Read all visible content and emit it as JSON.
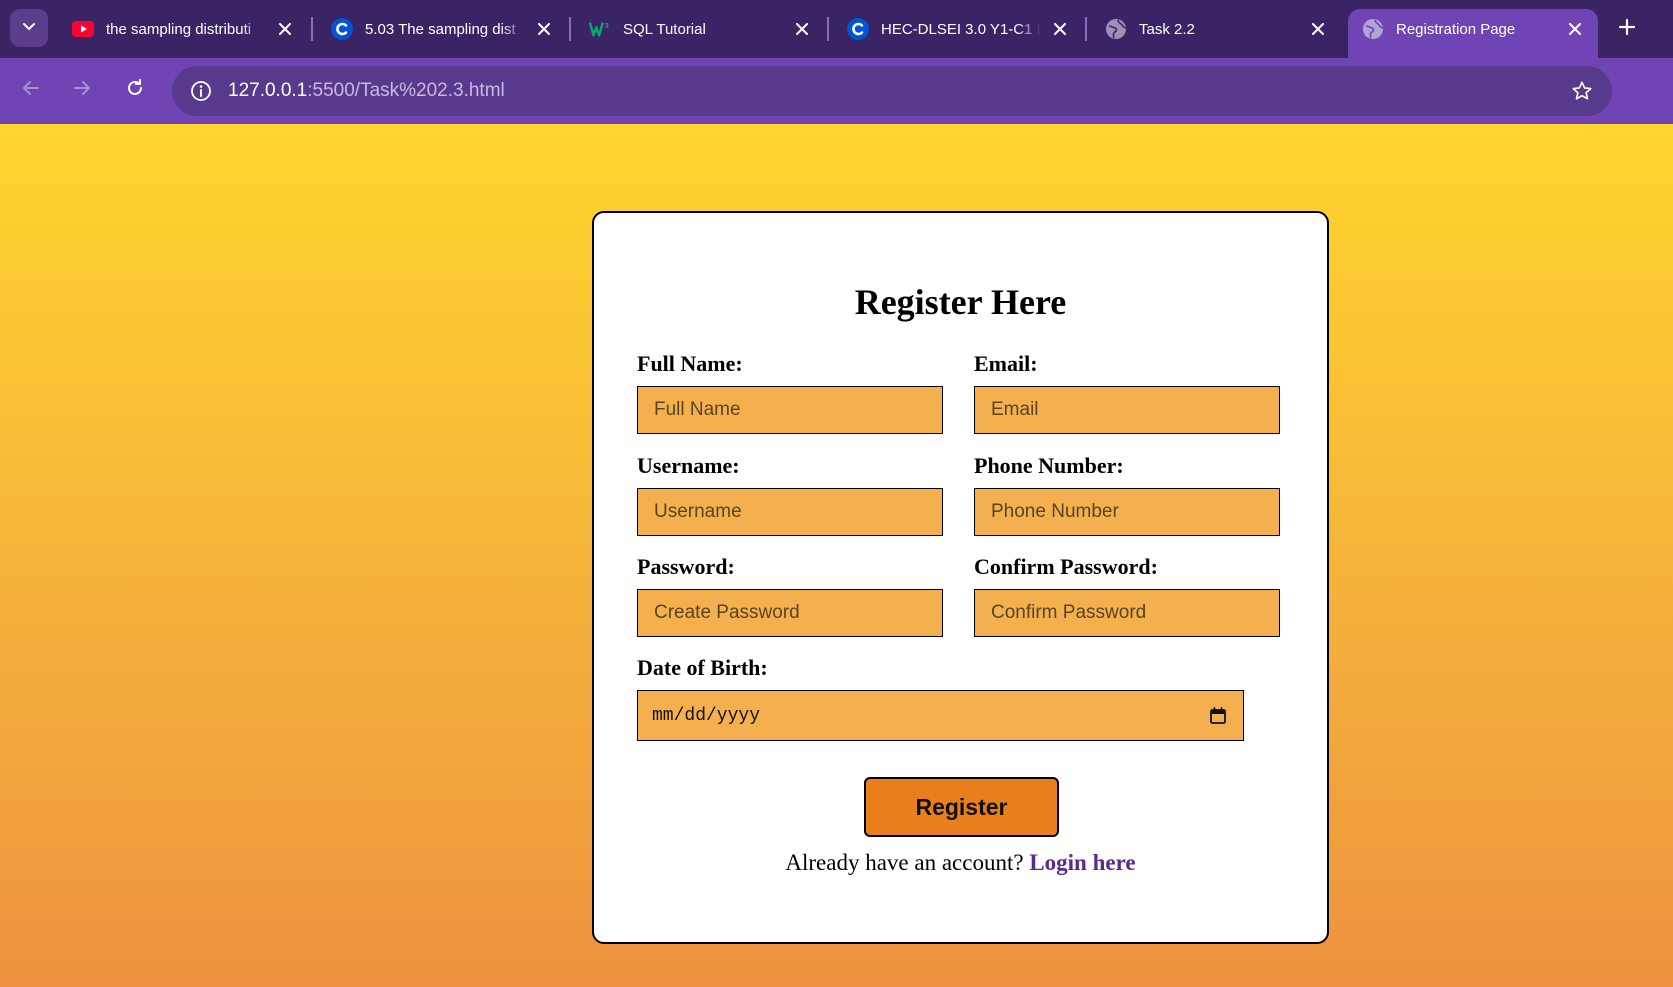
{
  "browser": {
    "tabs": [
      {
        "title": "the sampling distributi",
        "icon": "youtube-icon"
      },
      {
        "title": "5.03 The sampling dist",
        "icon": "coursera-icon"
      },
      {
        "title": "SQL Tutorial",
        "icon": "w3schools-icon"
      },
      {
        "title": "HEC-DLSEI 3.0 Y1-C1 I",
        "icon": "coursera-icon"
      },
      {
        "title": "Task 2.2",
        "icon": "globe-icon"
      },
      {
        "title": "Registration Page",
        "icon": "globe-icon",
        "active": true
      }
    ],
    "url_host": "127.0.0.1",
    "url_path": ":5500/Task%202.3.html",
    "colors": {
      "tabbar": "#3b2466",
      "toolbar": "#7044b4",
      "omnibox": "#573a8c"
    }
  },
  "form": {
    "heading": "Register Here",
    "fields": {
      "full_name": {
        "label": "Full Name:",
        "placeholder": "Full Name"
      },
      "email": {
        "label": "Email:",
        "placeholder": "Email"
      },
      "username": {
        "label": "Username:",
        "placeholder": "Username"
      },
      "phone": {
        "label": "Phone Number:",
        "placeholder": "Phone Number"
      },
      "password": {
        "label": "Password:",
        "placeholder": "Create Password"
      },
      "confirm_password": {
        "label": "Confirm Password:",
        "placeholder": "Confirm Password"
      },
      "dob": {
        "label": "Date of Birth:",
        "placeholder": "mm/dd/yyyy"
      }
    },
    "submit_label": "Register",
    "login_prompt": "Already have an account?",
    "login_link": "Login here",
    "colors": {
      "input_bg": "#f4b04e",
      "button_bg": "#e87e1c",
      "link": "#5a2a8e",
      "page_gradient_top": "#ffd52d",
      "page_gradient_bottom": "#ee923f"
    }
  }
}
